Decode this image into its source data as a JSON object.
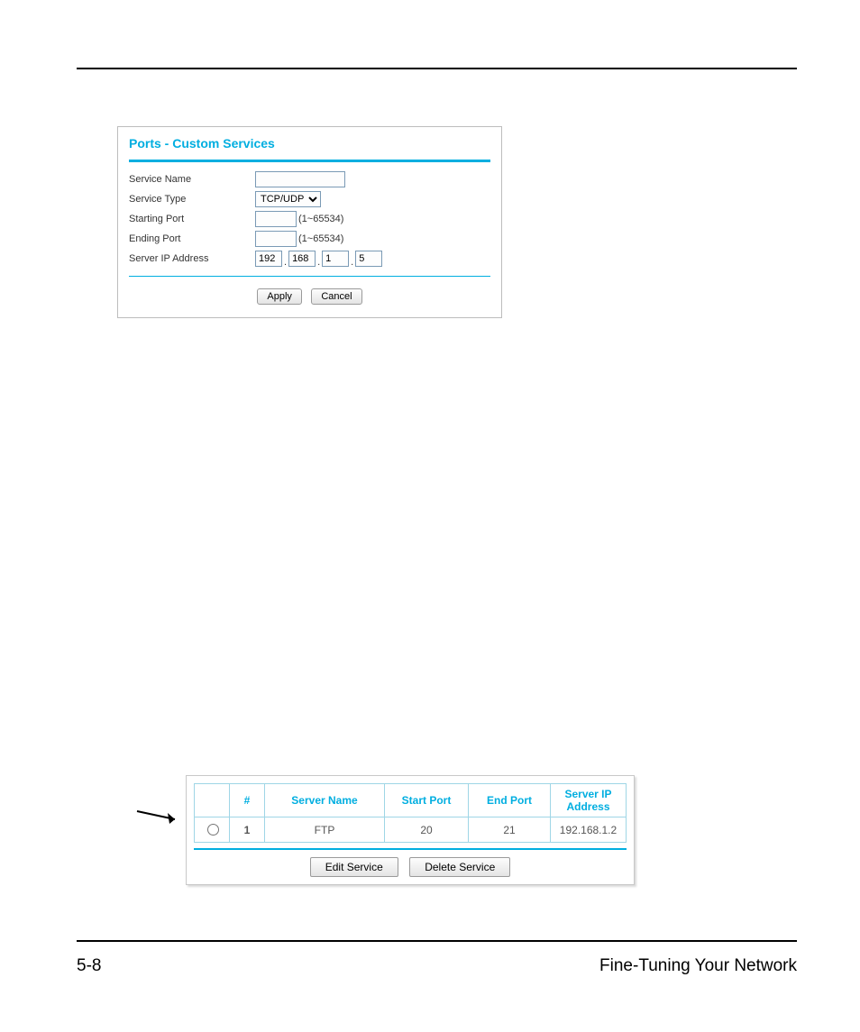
{
  "footer": {
    "page": "5-8",
    "section": "Fine-Tuning Your Network"
  },
  "panel1": {
    "title": "Ports - Custom Services",
    "labels": {
      "service_name": "Service Name",
      "service_type": "Service Type",
      "starting_port": "Starting Port",
      "ending_port": "Ending Port",
      "server_ip": "Server IP Address"
    },
    "values": {
      "service_name": "",
      "service_type": "TCP/UDP",
      "starting_port": "",
      "ending_port": "",
      "port_hint": "(1~65534)",
      "ip": {
        "a": "192",
        "b": "168",
        "c": "1",
        "d": "5"
      }
    },
    "buttons": {
      "apply": "Apply",
      "cancel": "Cancel"
    }
  },
  "panel2": {
    "headers": {
      "radio": "",
      "num": "#",
      "name": "Server Name",
      "start": "Start Port",
      "end": "End Port",
      "ip": "Server IP Address"
    },
    "row": {
      "num": "1",
      "name": "FTP",
      "start": "20",
      "end": "21",
      "ip": "192.168.1.2"
    },
    "buttons": {
      "edit": "Edit Service",
      "delete": "Delete Service"
    }
  }
}
